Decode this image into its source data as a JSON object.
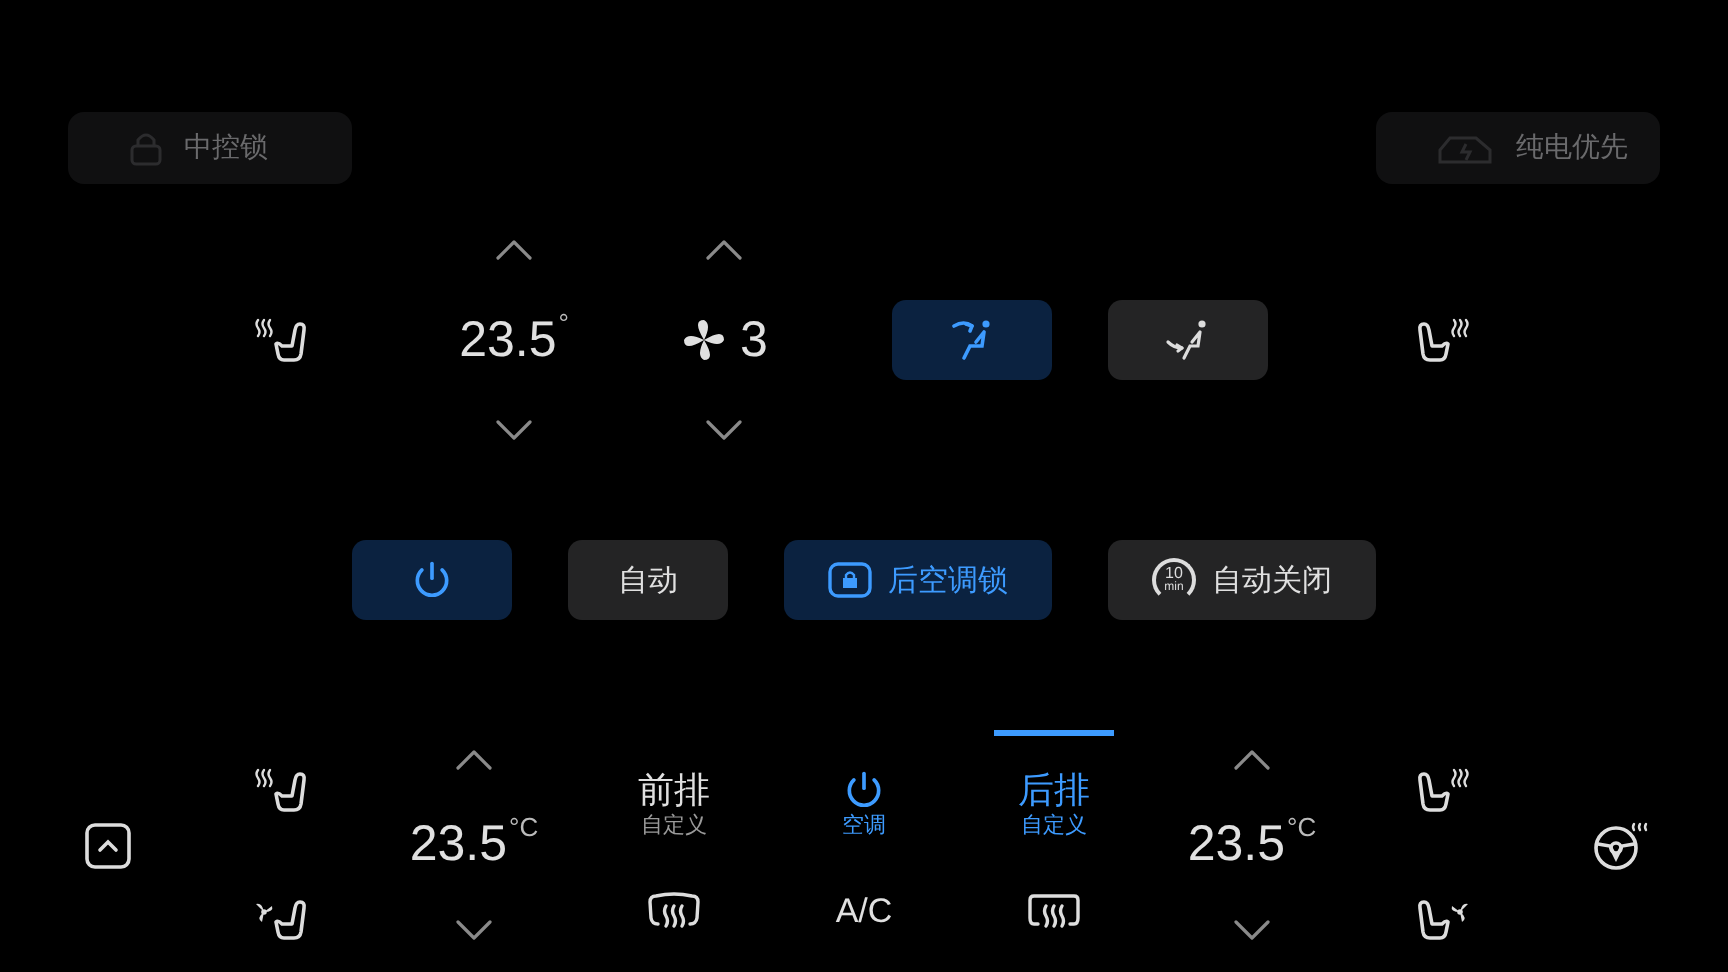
{
  "background_shortcuts": [
    {
      "kind": "lock",
      "label": "中控锁"
    },
    {
      "kind": "car",
      "label": "纯电优先"
    }
  ],
  "front_panel": {
    "temperature": {
      "value": "23.5",
      "unit": "°"
    },
    "fan": {
      "speed": "3"
    },
    "airflow": [
      {
        "kind": "face",
        "selected": true
      },
      {
        "kind": "feet",
        "selected": false
      }
    ]
  },
  "controls": [
    {
      "kind": "power",
      "selected": true
    },
    {
      "kind": "text",
      "label": "自动",
      "selected": false
    },
    {
      "kind": "lock",
      "label": "后空调锁",
      "selected": true
    },
    {
      "kind": "timer",
      "label": "自动关闭",
      "timer_value": "10",
      "timer_unit": "min",
      "selected": false
    }
  ],
  "left_temperature": {
    "value": "23.5",
    "unit": "°C"
  },
  "right_temperature": {
    "value": "23.5",
    "unit": "°C"
  },
  "zones": [
    {
      "kind": "tab",
      "title": "前排",
      "subtitle": "自定义",
      "selected": false,
      "footer": {
        "kind": "front_defrost"
      }
    },
    {
      "kind": "power",
      "subtitle": "空调",
      "selected": true,
      "footer": {
        "kind": "text",
        "label": "A/C"
      }
    },
    {
      "kind": "tab",
      "title": "后排",
      "subtitle": "自定义",
      "selected": true,
      "footer": {
        "kind": "rear_defrost"
      }
    }
  ]
}
